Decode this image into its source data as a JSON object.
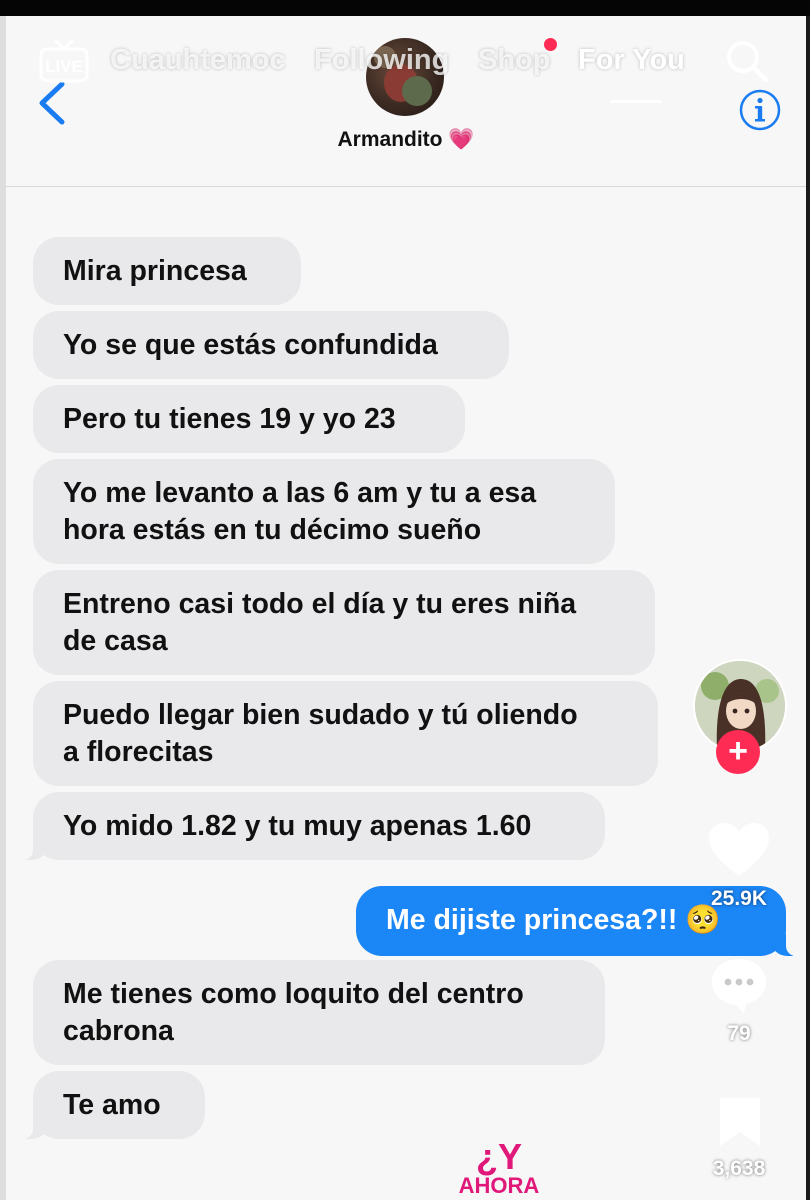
{
  "chat": {
    "contact_name": "Armandito 💗",
    "messages": [
      {
        "from": "them",
        "text": "Mira princesa"
      },
      {
        "from": "them",
        "text": "Yo se que estás confundida"
      },
      {
        "from": "them",
        "text": "Pero tu tienes 19 y yo 23"
      },
      {
        "from": "them",
        "text": "Yo me levanto a las 6 am y tu a esa\nhora estás en tu décimo sueño"
      },
      {
        "from": "them",
        "text": "Entreno casi todo el día y tu eres niña\nde casa"
      },
      {
        "from": "them",
        "text": "Puedo llegar bien sudado y tú oliendo\na florecitas"
      },
      {
        "from": "them",
        "text": "Yo mido 1.82 y tu muy apenas 1.60"
      },
      {
        "from": "me",
        "text": "Me dijiste princesa?!! 🥺"
      },
      {
        "from": "them",
        "text": "Me tienes como loquito del centro\ncabrona"
      },
      {
        "from": "them",
        "text": "Te amo"
      }
    ]
  },
  "tiktok": {
    "nav": {
      "live_label": "LIVE",
      "tabs": [
        "Cuauhtemoc",
        "Following",
        "Shop",
        "For You"
      ],
      "active_tab": "For You"
    },
    "likes": "25.9K",
    "comments": "79",
    "saves": "3,638",
    "follow_symbol": "+",
    "watermark": {
      "line1": "¿Y",
      "line2": "AHORA"
    }
  },
  "colors": {
    "incoming_bubble": "#e9e9eb",
    "outgoing_bubble": "#1b86f5",
    "accent": "#fe2c55",
    "ios_blue": "#1a7cf0"
  }
}
